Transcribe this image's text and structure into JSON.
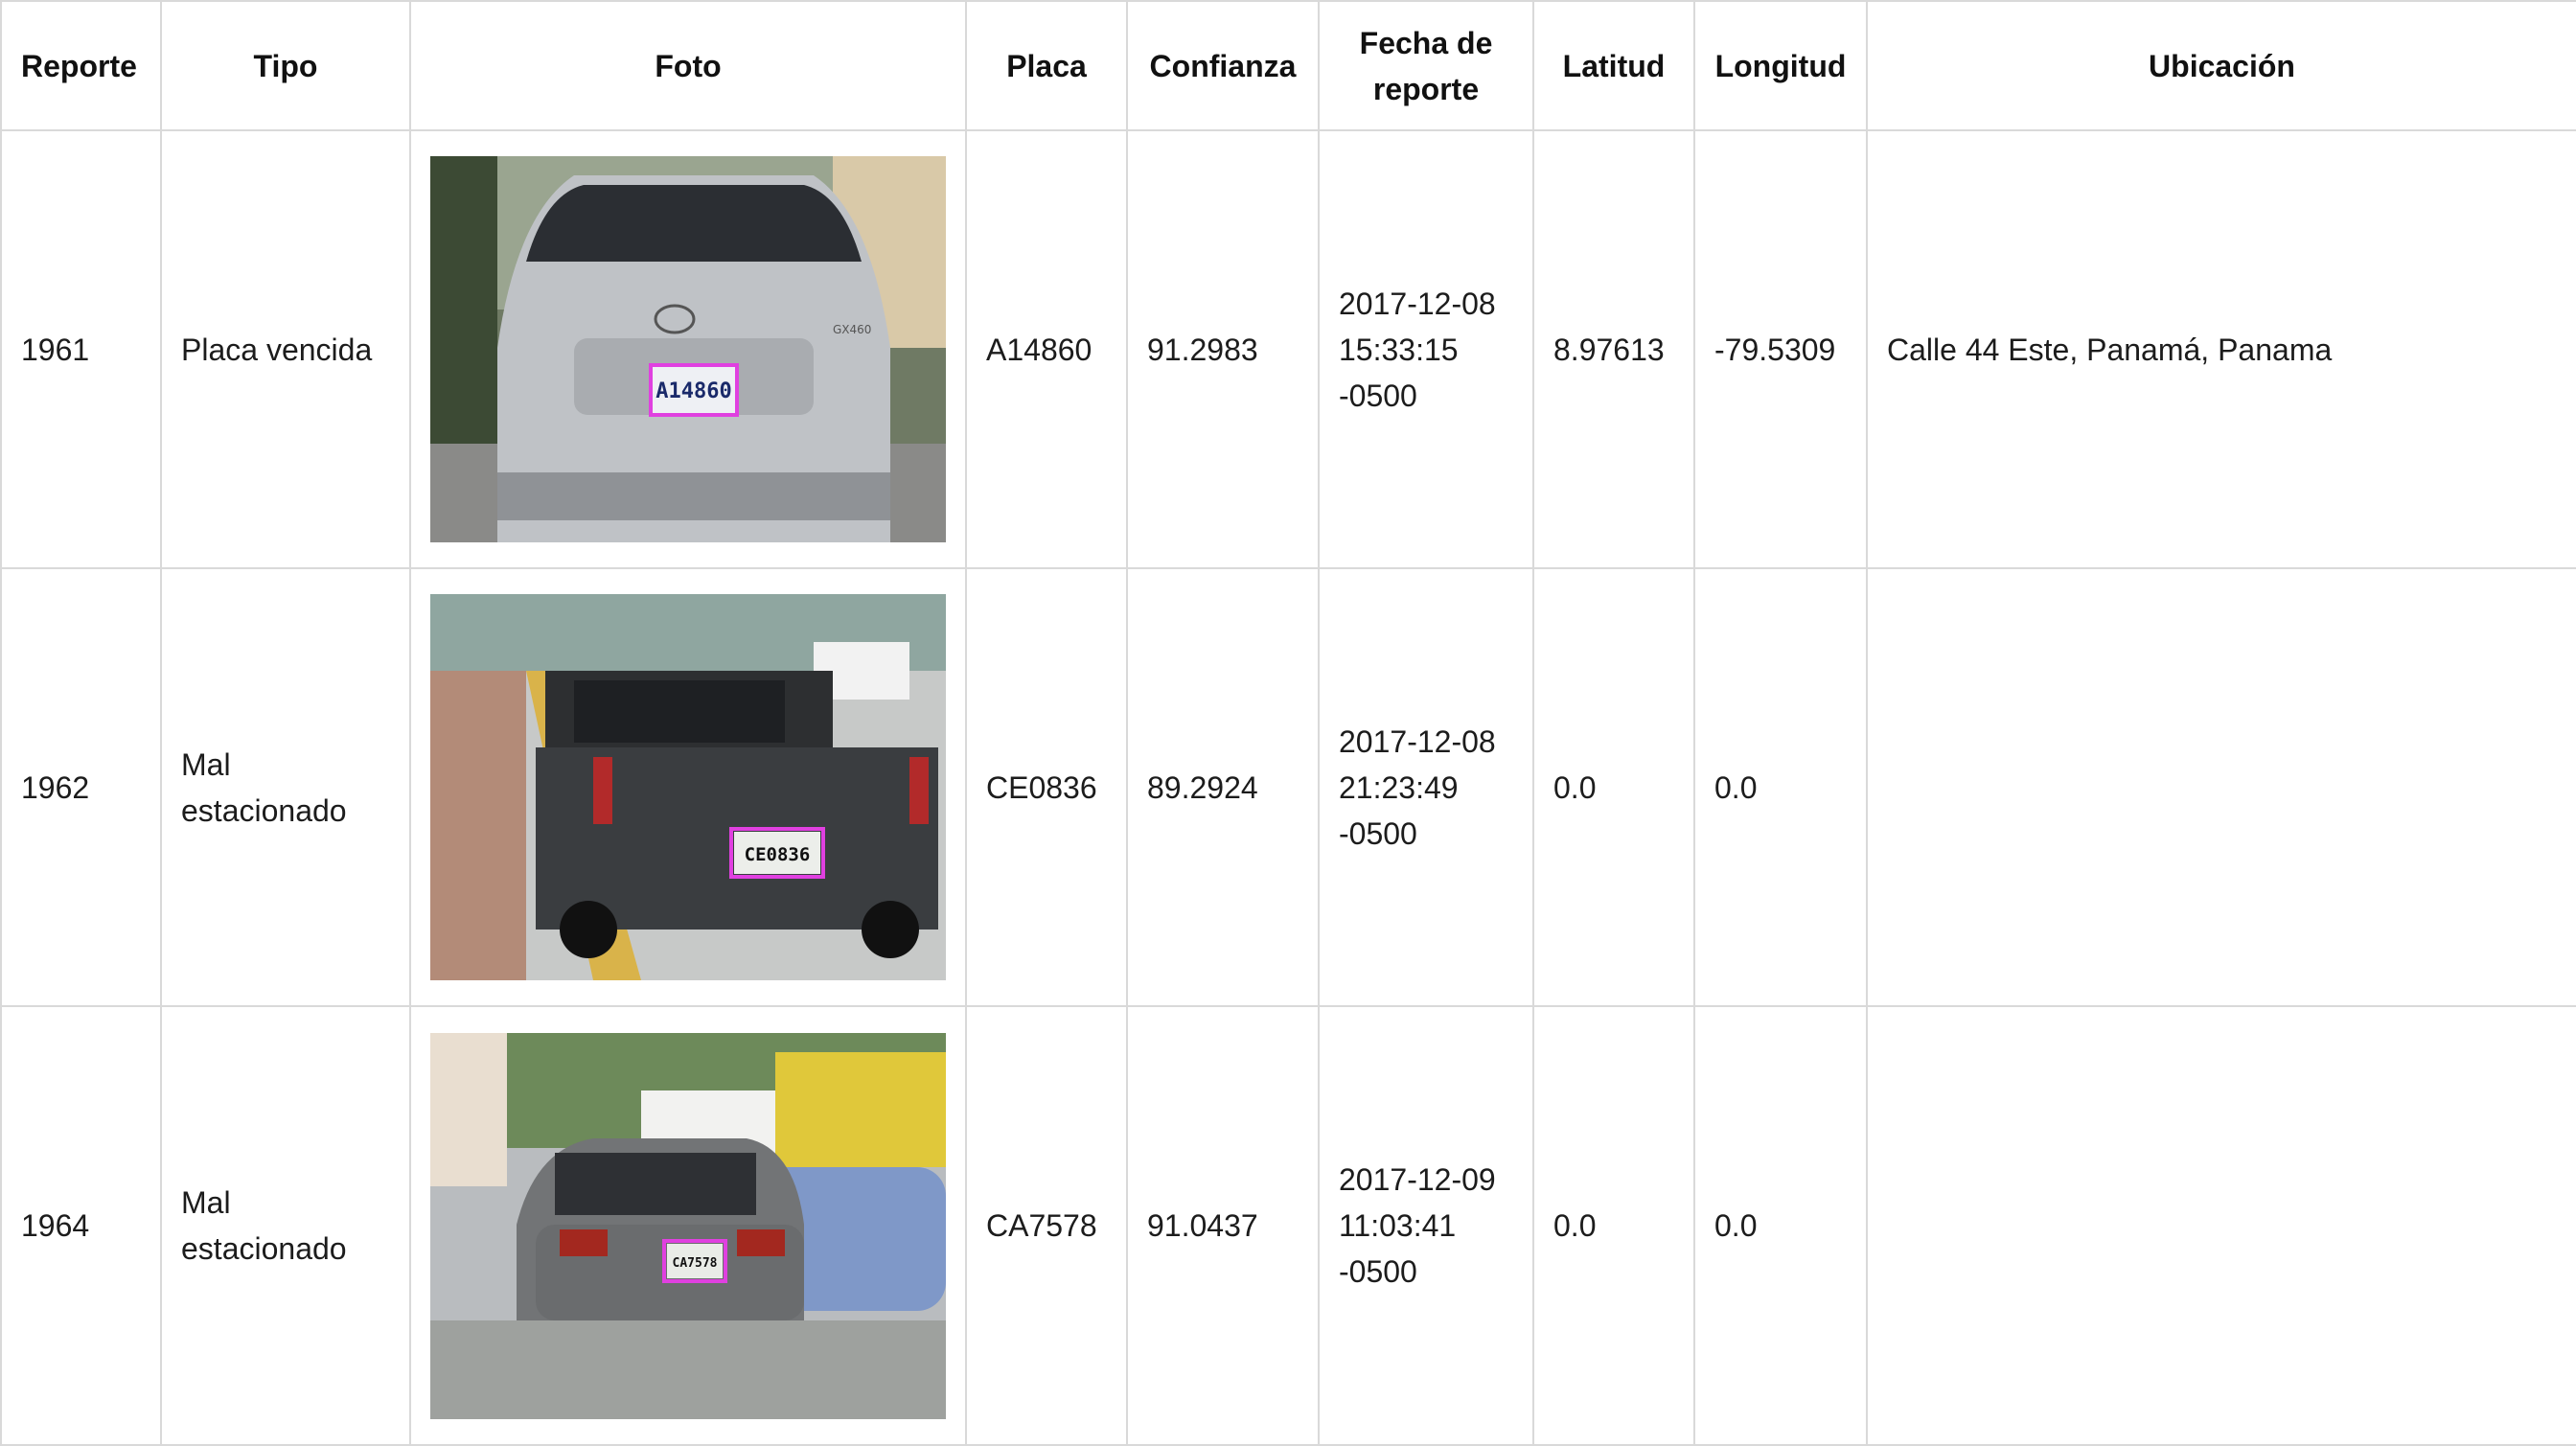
{
  "headers": {
    "reporte": "Reporte",
    "tipo": "Tipo",
    "foto": "Foto",
    "placa": "Placa",
    "confianza": "Confianza",
    "fecha": "Fecha de reporte",
    "latitud": "Latitud",
    "longitud": "Longitud",
    "ubicacion": "Ubicación"
  },
  "rows": [
    {
      "reporte": "1961",
      "tipo": "Placa vencida",
      "foto": {
        "plate_text": "A14860",
        "vehicle": "silver-suv-icon",
        "badge": "GX460"
      },
      "placa": "A14860",
      "confianza": "91.2983",
      "fecha": "2017-12-08 15:33:15 -0500",
      "latitud": "8.97613",
      "longitud": "-79.5309",
      "ubicacion": "Calle 44 Este, Panamá, Panama"
    },
    {
      "reporte": "1962",
      "tipo": "Mal estacionado",
      "foto": {
        "plate_text": "CE0836",
        "vehicle": "black-pickup-icon"
      },
      "placa": "CE0836",
      "confianza": "89.2924",
      "fecha": "2017-12-08 21:23:49 -0500",
      "latitud": "0.0",
      "longitud": "0.0",
      "ubicacion": ""
    },
    {
      "reporte": "1964",
      "tipo": "Mal estacionado",
      "foto": {
        "plate_text": "CA7578",
        "vehicle": "gray-sedan-icon"
      },
      "placa": "CA7578",
      "confianza": "91.0437",
      "fecha": "2017-12-09 11:03:41 -0500",
      "latitud": "0.0",
      "longitud": "0.0",
      "ubicacion": ""
    }
  ],
  "colors": {
    "border": "#d9d9d9",
    "text": "#1c1c1c",
    "plate_highlight": "#e040e0"
  }
}
